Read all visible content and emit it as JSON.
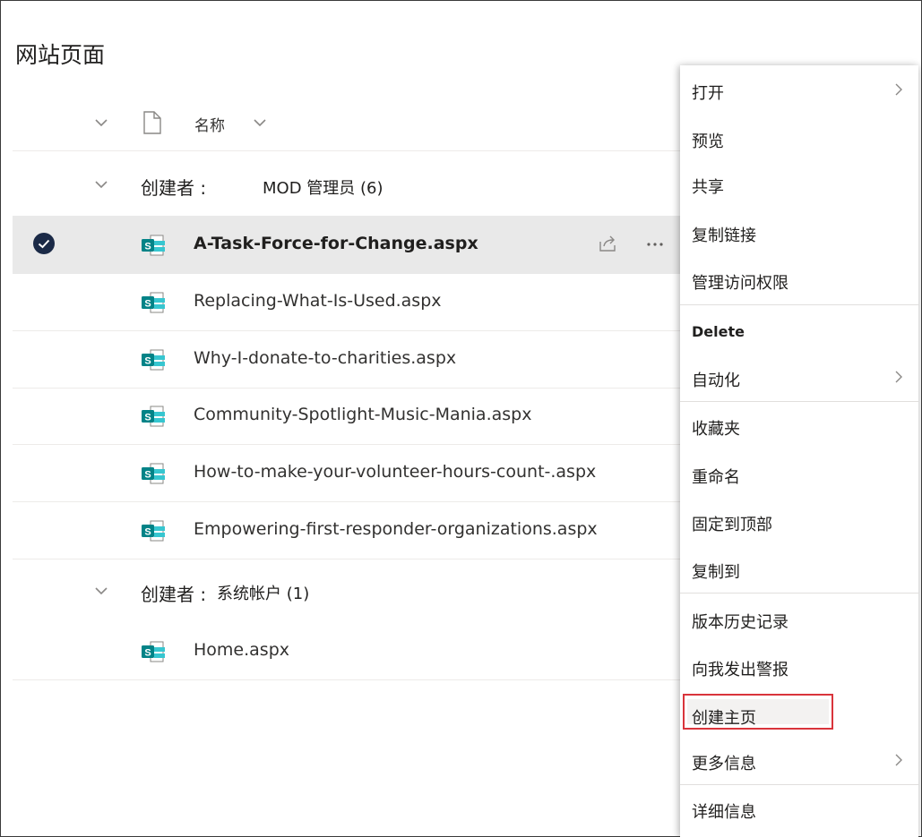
{
  "page": {
    "title": "网站页面"
  },
  "column_header": {
    "name_label": "名称"
  },
  "groups": [
    {
      "label": "创建者 :",
      "value": "MOD 管理员 (6)",
      "files": [
        {
          "name": "A-Task-Force-for-Change.aspx",
          "selected": true
        },
        {
          "name": "Replacing-What-Is-Used.aspx",
          "selected": false
        },
        {
          "name": "Why-I-donate-to-charities.aspx",
          "selected": false
        },
        {
          "name": "Community-Spotlight-Music-Mania.aspx",
          "selected": false
        },
        {
          "name": "How-to-make-your-volunteer-hours-count-.aspx",
          "selected": false
        },
        {
          "name": "Empowering-first-responder-organizations.aspx",
          "selected": false
        }
      ]
    },
    {
      "label": "创建者 :",
      "value": "系统帐户 (1)",
      "files": [
        {
          "name": "Home.aspx",
          "selected": false
        }
      ]
    }
  ],
  "context_menu": {
    "items": [
      {
        "label": "打开",
        "submenu": true
      },
      {
        "label": "预览",
        "submenu": false
      },
      {
        "label": "共享",
        "submenu": false
      },
      {
        "label": "复制链接",
        "submenu": false
      },
      {
        "label": "管理访问权限",
        "submenu": false
      },
      {
        "label": "Delete",
        "submenu": false
      },
      {
        "label": "自动化",
        "submenu": true
      },
      {
        "label": "收藏夹",
        "submenu": false
      },
      {
        "label": "重命名",
        "submenu": false
      },
      {
        "label": "固定到顶部",
        "submenu": false
      },
      {
        "label": "复制到",
        "submenu": false
      },
      {
        "label": "版本历史记录",
        "submenu": false
      },
      {
        "label": "向我发出警报",
        "submenu": false
      },
      {
        "label": "创建主页",
        "submenu": false,
        "highlighted": true
      },
      {
        "label": "更多信息",
        "submenu": true
      },
      {
        "label": "详细信息",
        "submenu": false
      }
    ]
  },
  "colors": {
    "selected_row_bg": "#e9e9e9",
    "sharepoint_teal": "#038387",
    "highlight_border": "#d9343b",
    "check_circle": "#1b2a47"
  },
  "icons": {
    "file_type": "sharepoint-page-icon",
    "header_file": "document-icon",
    "selected": "checkmark-circle-icon",
    "share": "share-icon",
    "more": "more-ellipsis-icon",
    "submenu": "chevron-right-icon"
  }
}
